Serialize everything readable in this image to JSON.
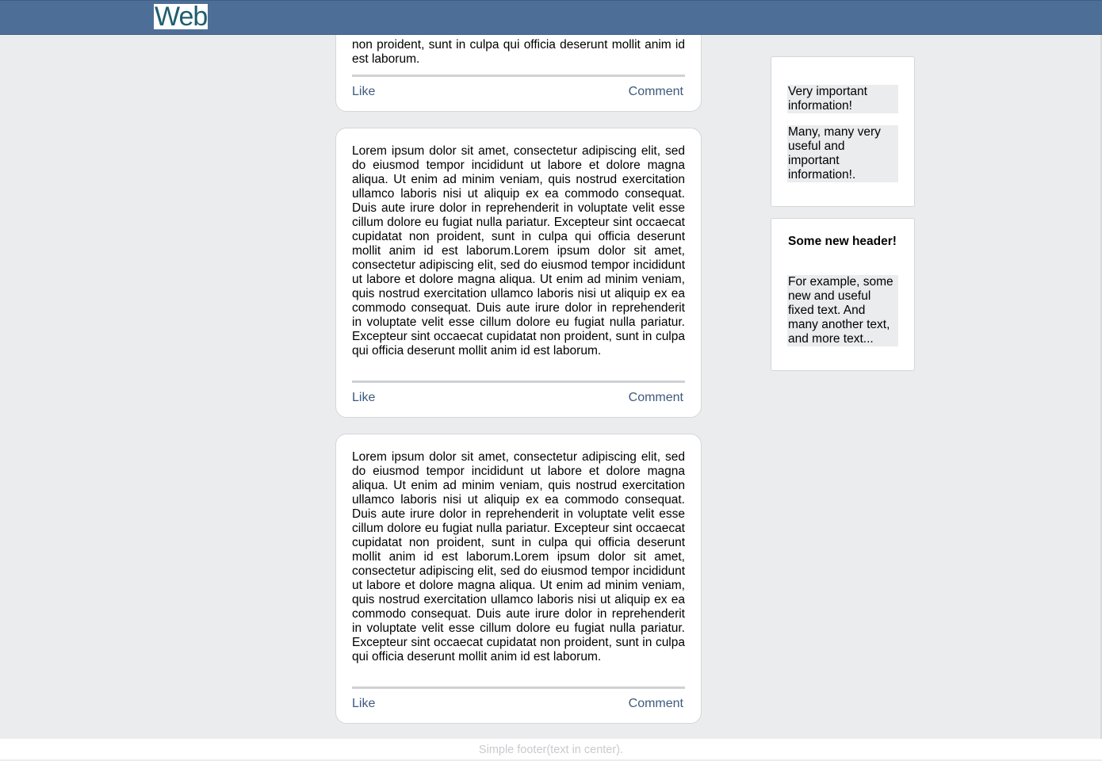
{
  "header": {
    "logo": "Web"
  },
  "posts": [
    {
      "text": "non proident, sunt in culpa qui officia deserunt mollit anim id est laborum.",
      "like": "Like",
      "comment": "Comment"
    },
    {
      "text": "Lorem ipsum dolor sit amet, consectetur adipiscing elit, sed do eiusmod tempor incididunt ut labore et dolore magna aliqua. Ut enim ad minim veniam, quis nostrud exercitation ullamco laboris nisi ut aliquip ex ea commodo consequat. Duis aute irure dolor in reprehenderit in voluptate velit esse cillum dolore eu fugiat nulla pariatur. Excepteur sint occaecat cupidatat non proident, sunt in culpa qui officia deserunt mollit anim id est laborum.Lorem ipsum dolor sit amet, consectetur adipiscing elit, sed do eiusmod tempor incididunt ut labore et dolore magna aliqua. Ut enim ad minim veniam, quis nostrud exercitation ullamco laboris nisi ut aliquip ex ea commodo consequat. Duis aute irure dolor in reprehenderit in voluptate velit esse cillum dolore eu fugiat nulla pariatur. Excepteur sint occaecat cupidatat non proident, sunt in culpa qui officia deserunt mollit anim id est laborum.",
      "like": "Like",
      "comment": "Comment"
    },
    {
      "text": "Lorem ipsum dolor sit amet, consectetur adipiscing elit, sed do eiusmod tempor incididunt ut labore et dolore magna aliqua. Ut enim ad minim veniam, quis nostrud exercitation ullamco laboris nisi ut aliquip ex ea commodo consequat. Duis aute irure dolor in reprehenderit in voluptate velit esse cillum dolore eu fugiat nulla pariatur. Excepteur sint occaecat cupidatat non proident, sunt in culpa qui officia deserunt mollit anim id est laborum.Lorem ipsum dolor sit amet, consectetur adipiscing elit, sed do eiusmod tempor incididunt ut labore et dolore magna aliqua. Ut enim ad minim veniam, quis nostrud exercitation ullamco laboris nisi ut aliquip ex ea commodo consequat. Duis aute irure dolor in reprehenderit in voluptate velit esse cillum dolore eu fugiat nulla pariatur. Excepteur sint occaecat cupidatat non proident, sunt in culpa qui officia deserunt mollit anim id est laborum.",
      "like": "Like",
      "comment": "Comment"
    }
  ],
  "sidebar": {
    "widget1": {
      "block1": "Very important information!",
      "block2": "Many, many very useful and important information!."
    },
    "widget2": {
      "header": "Some new header!",
      "block": "For example, some new and useful fixed text. And many another text, and more text..."
    }
  },
  "footer": {
    "text": "Simple footer(text in center)."
  },
  "colors": {
    "topbar": "#4d6f97",
    "page_background": "#ebecee",
    "link": "#3e5a7d",
    "logo_text": "#1f5e6e"
  }
}
